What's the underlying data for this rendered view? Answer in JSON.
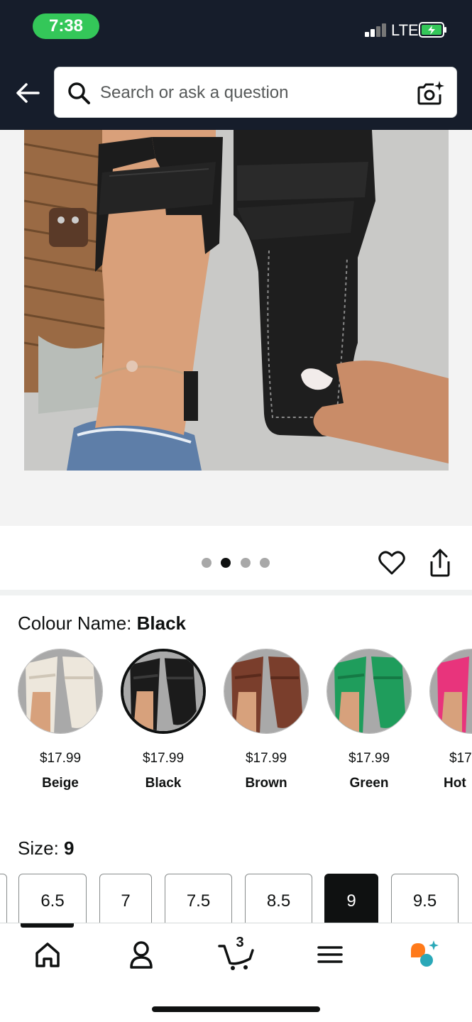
{
  "status_bar": {
    "time": "7:38",
    "network": "LTE"
  },
  "header": {
    "search_placeholder": "Search or ask a question",
    "back_icon": "arrow-left-icon",
    "camera_icon": "camera-sparkle-icon"
  },
  "gallery": {
    "image_count": 4,
    "active_index": 1
  },
  "colour": {
    "label": "Colour Name:",
    "selected": "Black",
    "options": [
      {
        "price": "$17.99",
        "name": "Beige",
        "color": "#ede7dc"
      },
      {
        "price": "$17.99",
        "name": "Black",
        "color": "#1b1b1b"
      },
      {
        "price": "$17.99",
        "name": "Brown",
        "color": "#7a3e2c"
      },
      {
        "price": "$17.99",
        "name": "Green",
        "color": "#1f9d5c"
      },
      {
        "price": "$17",
        "name": "Hot",
        "color": "#e8347c"
      }
    ]
  },
  "size": {
    "label": "Size:",
    "selected": "9",
    "options": [
      "6.5",
      "7",
      "7.5",
      "8.5",
      "9",
      "9.5"
    ]
  },
  "bottom_nav": {
    "cart_count": "3",
    "items": [
      "home-icon",
      "account-icon",
      "cart-icon",
      "menu-icon",
      "rufus-assistant-icon"
    ]
  },
  "colors": {
    "header_bg": "#161d2b",
    "status_pill": "#34c759",
    "assistant_orange": "#ff7a1a",
    "assistant_teal": "#2aa8b8"
  }
}
